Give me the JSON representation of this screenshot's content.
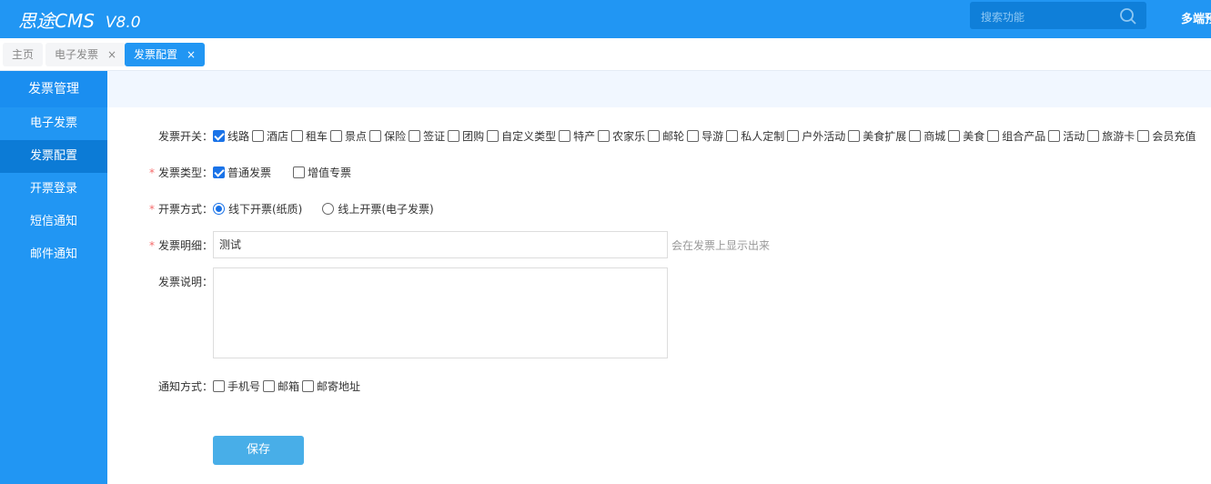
{
  "header": {
    "logo": "思途CMS",
    "version": "V8.0",
    "search_placeholder": "搜索功能",
    "multi": "多端预"
  },
  "tabs": [
    {
      "label": "主页"
    },
    {
      "label": "电子发票",
      "close": "×"
    },
    {
      "label": "发票配置",
      "close": "×"
    }
  ],
  "sidebar": {
    "title": "发票管理",
    "items": [
      {
        "label": "电子发票"
      },
      {
        "label": "发票配置"
      },
      {
        "label": "开票登录"
      },
      {
        "label": "短信通知"
      },
      {
        "label": "邮件通知"
      }
    ]
  },
  "form": {
    "switch_label": "发票开关：",
    "switch_options": [
      {
        "label": "线路",
        "checked": true
      },
      {
        "label": "酒店",
        "checked": false
      },
      {
        "label": "租车",
        "checked": false
      },
      {
        "label": "景点",
        "checked": false
      },
      {
        "label": "保险",
        "checked": false
      },
      {
        "label": "签证",
        "checked": false
      },
      {
        "label": "团购",
        "checked": false
      },
      {
        "label": "自定义类型",
        "checked": false
      },
      {
        "label": "特产",
        "checked": false
      },
      {
        "label": "农家乐",
        "checked": false
      },
      {
        "label": "邮轮",
        "checked": false
      },
      {
        "label": "导游",
        "checked": false
      },
      {
        "label": "私人定制",
        "checked": false
      },
      {
        "label": "户外活动",
        "checked": false
      },
      {
        "label": "美食扩展",
        "checked": false
      },
      {
        "label": "商城",
        "checked": false
      },
      {
        "label": "美食",
        "checked": false
      },
      {
        "label": "组合产品",
        "checked": false
      },
      {
        "label": "活动",
        "checked": false
      },
      {
        "label": "旅游卡",
        "checked": false
      },
      {
        "label": "会员充值",
        "checked": false
      }
    ],
    "required_mark": "*",
    "type_label": "发票类型：",
    "type_options": [
      {
        "label": "普通发票",
        "checked": true
      },
      {
        "label": "增值专票",
        "checked": false
      }
    ],
    "method_label": "开票方式：",
    "method_options": [
      {
        "label": "线下开票(纸质)",
        "selected": true
      },
      {
        "label": "线上开票(电子发票)",
        "selected": false
      }
    ],
    "detail_label": "发票明细：",
    "detail_value": "测试",
    "detail_hint": "会在发票上显示出来",
    "desc_label": "发票说明：",
    "desc_value": "",
    "notify_label": "通知方式：",
    "notify_options": [
      {
        "label": "手机号",
        "checked": false
      },
      {
        "label": "邮箱",
        "checked": false
      },
      {
        "label": "邮寄地址",
        "checked": false
      }
    ],
    "save": "保存"
  }
}
